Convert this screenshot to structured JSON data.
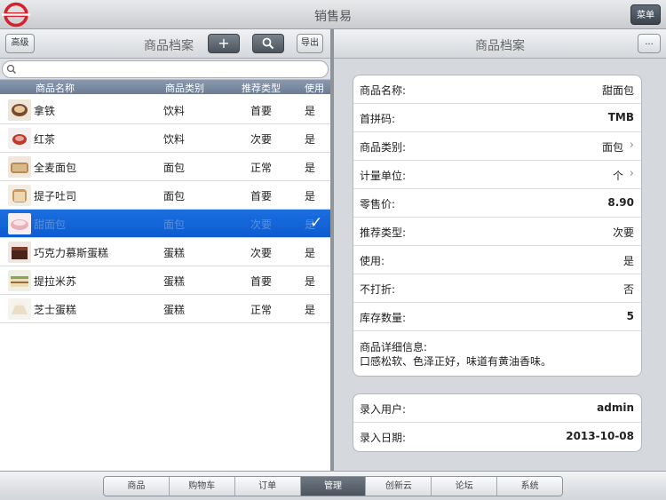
{
  "app": {
    "title": "销售易",
    "menu_label": "菜单"
  },
  "left": {
    "advanced_label": "高级",
    "title": "商品档案",
    "add_label": "+",
    "export_label": "导出",
    "search_placeholder": "",
    "columns": [
      "商品名称",
      "商品类别",
      "推荐类型",
      "使用"
    ],
    "rows": [
      {
        "name": "拿铁",
        "category": "饮料",
        "recommend": "首要",
        "use": "是"
      },
      {
        "name": "红茶",
        "category": "饮料",
        "recommend": "次要",
        "use": "是"
      },
      {
        "name": "全麦面包",
        "category": "面包",
        "recommend": "正常",
        "use": "是"
      },
      {
        "name": "提子吐司",
        "category": "面包",
        "recommend": "首要",
        "use": "是"
      },
      {
        "name": "甜面包",
        "category": "面包",
        "recommend": "次要",
        "use": "是",
        "check": "✓"
      },
      {
        "name": "巧克力慕斯蛋糕",
        "category": "蛋糕",
        "recommend": "次要",
        "use": "是"
      },
      {
        "name": "提拉米苏",
        "category": "蛋糕",
        "recommend": "首要",
        "use": "是"
      },
      {
        "name": "芝士蛋糕",
        "category": "蛋糕",
        "recommend": "正常",
        "use": "是"
      }
    ]
  },
  "right": {
    "title": "商品档案",
    "more_label": "...",
    "fields": {
      "name_label": "商品名称:",
      "name_value": "甜面包",
      "pinyin_label": "首拼码:",
      "pinyin_value": "TMB",
      "category_label": "商品类别:",
      "category_value": "面包",
      "unit_label": "计量单位:",
      "unit_value": "个",
      "price_label": "零售价:",
      "price_value": "8.90",
      "recommend_label": "推荐类型:",
      "recommend_value": "次要",
      "use_label": "使用:",
      "use_value": "是",
      "nodiscount_label": "不打折:",
      "nodiscount_value": "否",
      "stock_label": "库存数量:",
      "stock_value": "5",
      "desc_label": "商品详细信息:",
      "desc_value": "口感松软、色泽正好，味道有黄油香味。"
    },
    "audit": {
      "user_label": "录入用户:",
      "user_value": "admin",
      "date_label": "录入日期:",
      "date_value": "2013-10-08"
    }
  },
  "tabs": [
    "商品",
    "购物车",
    "订单",
    "管理",
    "创新云",
    "论坛",
    "系统"
  ],
  "active_tab": "管理",
  "colors": {
    "accent": "#0d5bd0",
    "logo_red": "#d6202a"
  }
}
